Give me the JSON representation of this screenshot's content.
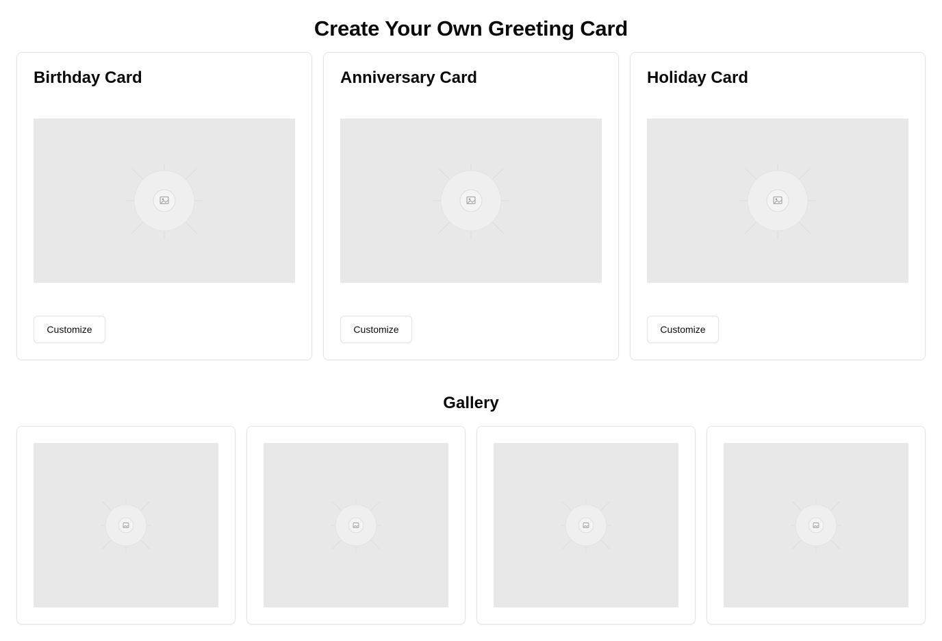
{
  "page": {
    "title": "Create Your Own Greeting Card"
  },
  "templates": [
    {
      "title": "Birthday Card",
      "button_label": "Customize",
      "image_icon": "image-placeholder-icon"
    },
    {
      "title": "Anniversary Card",
      "button_label": "Customize",
      "image_icon": "image-placeholder-icon"
    },
    {
      "title": "Holiday Card",
      "button_label": "Customize",
      "image_icon": "image-placeholder-icon"
    }
  ],
  "gallery": {
    "title": "Gallery",
    "items": [
      {
        "image_icon": "image-placeholder-icon"
      },
      {
        "image_icon": "image-placeholder-icon"
      },
      {
        "image_icon": "image-placeholder-icon"
      },
      {
        "image_icon": "image-placeholder-icon"
      }
    ]
  },
  "colors": {
    "placeholder_bg": "#e8e8e8",
    "border": "#e4e4e7",
    "text": "#0a0a0a"
  }
}
